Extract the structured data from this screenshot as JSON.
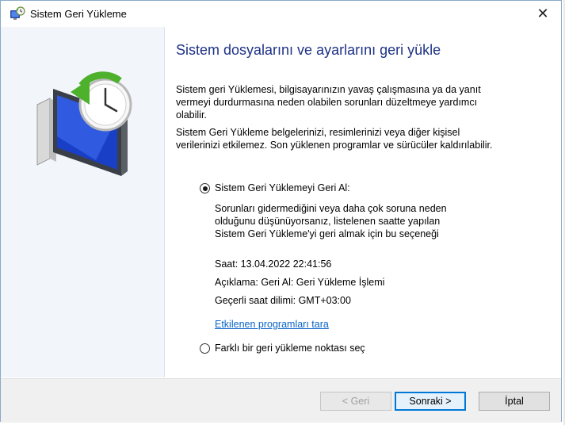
{
  "window": {
    "title": "Sistem Geri Yükleme",
    "close_symbol": "✕"
  },
  "main": {
    "heading": "Sistem dosyalarını ve ayarlarını geri yükle",
    "para1_line1": "Sistem geri Yüklemesi, bilgisayarınızın yavaş çalışmasına ya da yanıt",
    "para1_line2": "vermeyi durdurmasına neden olabilen sorunları düzeltmeye yardımcı",
    "para1_line3": "olabilir.",
    "para2_line1": "Sistem Geri Yükleme belgelerinizi, resimlerinizi veya diğer kişisel",
    "para2_line2": "verilerinizi etkilemez. Son yüklenen programlar ve sürücüler kaldırılabilir."
  },
  "options": {
    "undo_label": "Sistem Geri Yüklemeyi Geri Al:",
    "undo_desc_line1": "Sorunları gidermediğini veya daha çok soruna neden",
    "undo_desc_line2": "olduğunu düşünüyorsanız, listelenen saatte yapılan",
    "undo_desc_line3": "Sistem Geri Yükleme'yi geri almak için bu seçeneği",
    "time": "Saat: 13.04.2022 22:41:56",
    "description": "Açıklama: Geri Al: Geri Yükleme İşlemi",
    "timezone": "Geçerli saat dilimi: GMT+03:00",
    "scan_link": "Etkilenen programları tara",
    "other_label": "Farklı bir geri yükleme noktası seç",
    "selected": "undo"
  },
  "footer": {
    "back_label": "< Geri",
    "next_label": "Sonraki >",
    "cancel_label": "İptal"
  },
  "colors": {
    "heading": "#1e3287",
    "link": "#0a64c8",
    "side_panel": "#f2f6fb"
  },
  "icons": {
    "title": "system-restore-icon",
    "side": "system-restore-monitor-clock-icon"
  }
}
